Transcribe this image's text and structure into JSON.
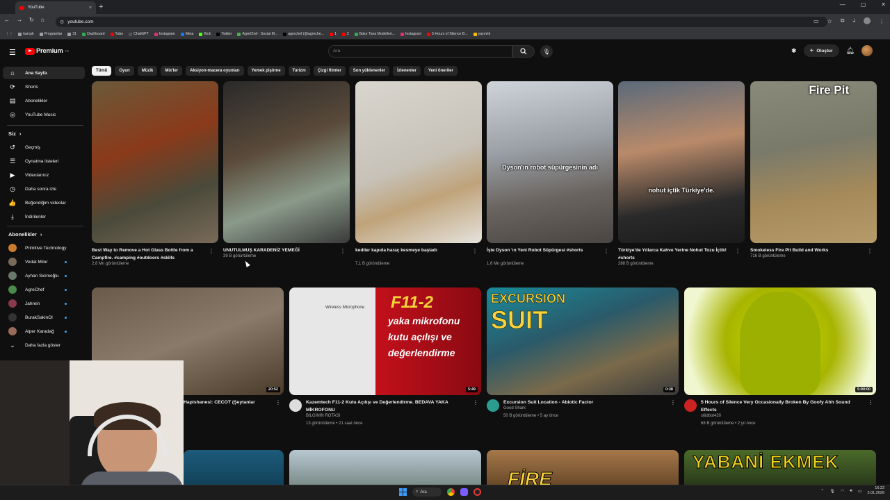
{
  "browser": {
    "tab_title": "YouTube",
    "tab_close": "×",
    "new_tab": "+",
    "url": "youtube.com",
    "window_controls": [
      "—",
      "▢",
      "✕"
    ],
    "bookmarks": [
      {
        "label": "karışık",
        "color": "#9aa0a6"
      },
      {
        "label": "Programlar",
        "color": "#9aa0a6"
      },
      {
        "label": "31",
        "color": "#9aa0a6"
      },
      {
        "label": "Dashboard",
        "color": "#34a853"
      },
      {
        "label": "Tube",
        "color": "#ff0000"
      },
      {
        "label": "ChatGPT",
        "color": "#555555"
      },
      {
        "label": "Instagram",
        "color": "#e1306c"
      },
      {
        "label": "Meta",
        "color": "#1877f2"
      },
      {
        "label": "Kick",
        "color": "#53fc18"
      },
      {
        "label": "Twitter",
        "color": "#000000"
      },
      {
        "label": "AgreChef - Social M...",
        "color": "#4caf50"
      },
      {
        "label": "agrechef (@agreche...",
        "color": "#000000"
      },
      {
        "label": "1",
        "color": "#ff0000"
      },
      {
        "label": "2",
        "color": "#ff0000"
      },
      {
        "label": "Bakır Tava Modelleri...",
        "color": "#34a853"
      },
      {
        "label": "Instagram",
        "color": "#e1306c"
      },
      {
        "label": "5 Hours of Silence B...",
        "color": "#ff0000"
      },
      {
        "label": "yayınlık",
        "color": "#fbbc04"
      }
    ]
  },
  "header": {
    "logo_text": "Premium",
    "logo_sup": "TR",
    "search_placeholder": "Ara",
    "create_label": "Oluştur"
  },
  "sidebar": {
    "main_items": [
      {
        "label": "Ana Sayfa",
        "icon": "home-icon",
        "glyph": "⌂",
        "active": true
      },
      {
        "label": "Shorts",
        "icon": "shorts-icon",
        "glyph": "⟳",
        "active": false
      },
      {
        "label": "Abonelikler",
        "icon": "subscriptions-icon",
        "glyph": "▤",
        "active": false
      },
      {
        "label": "YouTube Music",
        "icon": "music-icon",
        "glyph": "◎",
        "active": false
      }
    ],
    "you_header": "Siz",
    "you_items": [
      {
        "label": "Geçmiş",
        "icon": "history-icon",
        "glyph": "↺"
      },
      {
        "label": "Oynatma listeleri",
        "icon": "playlists-icon",
        "glyph": "☰"
      },
      {
        "label": "Videolarınız",
        "icon": "your-videos-icon",
        "glyph": "▶"
      },
      {
        "label": "Daha sonra izle",
        "icon": "watch-later-icon",
        "glyph": "◷"
      },
      {
        "label": "Beğendiğim videolar",
        "icon": "liked-videos-icon",
        "glyph": "👍"
      },
      {
        "label": "İndirilenler",
        "icon": "downloads-icon",
        "glyph": "⤓"
      }
    ],
    "subs_header": "Abonelikler",
    "subscriptions": [
      {
        "label": "Primitive Technology",
        "color": "#c97a2a"
      },
      {
        "label": "Vedat Milor",
        "color": "#7a6a5a"
      },
      {
        "label": "Ayhan Sicimoğlu",
        "color": "#6a7a6a"
      },
      {
        "label": "AgreChef",
        "color": "#4a8a4a"
      },
      {
        "label": "Jahrein",
        "color": "#8a3a4a"
      },
      {
        "label": "BurakSakinOl",
        "color": "#333333"
      },
      {
        "label": "Alper Karadağ",
        "color": "#9a6a5a"
      }
    ],
    "more_label": "Daha fazla göster"
  },
  "chips": [
    "Tümü",
    "Oyun",
    "Müzik",
    "Mix'ler",
    "Aksiyon-macera oyunları",
    "Yemek pişirme",
    "Turizm",
    "Çizgi filmler",
    "Son yüklenenler",
    "İzlenenler",
    "Yeni öneriler"
  ],
  "shorts": [
    {
      "title": "Best Way to Remove a Hot Glass Bottle from a Campfire. #camping #outdoors #skills",
      "views": "2,8 Mn görüntüleme",
      "overlay": ""
    },
    {
      "title": "UNUTULMUŞ KARADENİZ YEMEĞİ",
      "views": "39 B görüntüleme",
      "overlay": ""
    },
    {
      "title": "kediler kapıda haraç kesmeye başladı",
      "views": "7,1 B görüntüleme",
      "overlay": ""
    },
    {
      "title": "İşte Dyson 'ın Yeni Robot Süpürgesi #shorts",
      "views": "1,6 Mn görüntüleme",
      "overlay": "Dyson'ın robot süpürgesinin adı"
    },
    {
      "title": "Türkiye'de Yıllarca Kahve Yerine Nohut Tozu İçtik! #shorts",
      "views": "288 B görüntüleme",
      "overlay": "nohut içtik Türkiye'de."
    },
    {
      "title": "Smokeless Fire Pit Build and Works",
      "views": "716 B görüntüleme",
      "overlay": "Fire Pit"
    }
  ],
  "videos": [
    {
      "title": "Hapishanesi: CECOT (Şeytanlar",
      "channel": "",
      "info": "",
      "duration": "20:52",
      "avatar_color": "#555555"
    },
    {
      "title": "Kazemtech  F11-2 Kutu Açılışı ve Değerlendirme. BEDAVA YAKA MİKROFONU",
      "channel": "BİLGİNİN ROTASI",
      "info": "13 görüntüleme • 21 saat önce",
      "duration": "5:49",
      "avatar_color": "#dddddd",
      "thumb_text": [
        "F11-2",
        "yaka mikrofonu",
        "kutu açılışı ve",
        "değerlendirme"
      ],
      "thumb_label": "Wireless Microphone"
    },
    {
      "title": "Excursion Suit Location - Abiotic Factor",
      "channel": "Good Shark",
      "info": "50 B görüntüleme • 5 ay önce",
      "duration": "0:38",
      "avatar_color": "#2a9d8f",
      "thumb_text": [
        "EXCURSION",
        "SUIT"
      ]
    },
    {
      "title": "5 Hours of Silence Very Occasionally Broken By Goofy Ahh Sound Effects",
      "channel": "stiidbot420",
      "info": "68 B görüntüleme • 2 yıl önce",
      "duration": "5:00:00",
      "avatar_color": "#cc2222"
    }
  ],
  "row3": {
    "last_thumb_text": "YABANİ EKMEK",
    "fire_text": "FİRE"
  },
  "taskbar": {
    "search_label": "Ara",
    "time": "16:22",
    "date": "3.01.2026"
  },
  "colors": {
    "accent": "#ff0000",
    "background": "#0f0f0f",
    "chip_active": "#f1f1f1",
    "link": "#3ea6ff"
  }
}
